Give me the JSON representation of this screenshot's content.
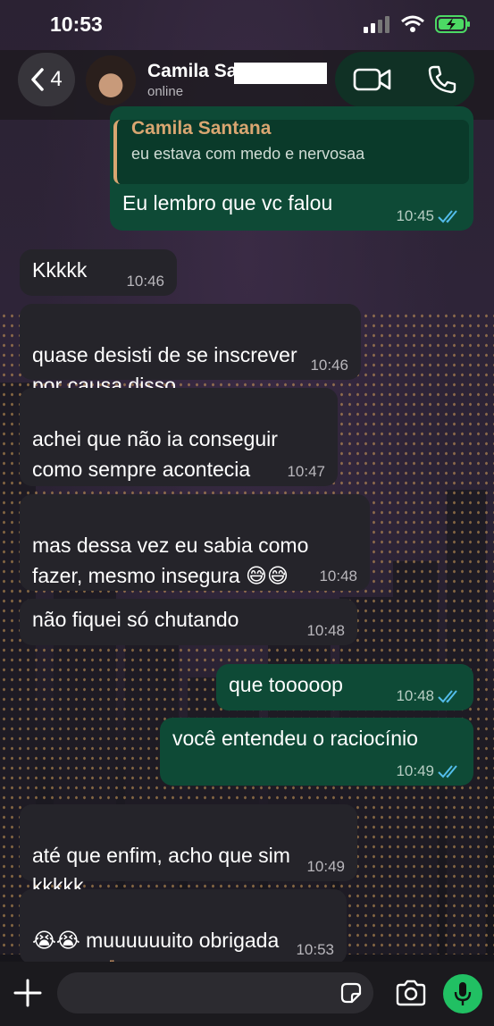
{
  "status_bar": {
    "time": "10:53"
  },
  "header": {
    "back_count": "4",
    "contact_name": "Camila Sa",
    "contact_status": "online"
  },
  "quoted": {
    "name": "Camila Santana",
    "text": "eu estava com medo e nervosaa"
  },
  "messages": [
    {
      "text": "Eu lembro que vc falou",
      "time": "10:45",
      "dir": "out"
    },
    {
      "text": "Kkkkk",
      "time": "10:46",
      "dir": "in"
    },
    {
      "text": "quase desisti de se inscrever\npor causa disso",
      "time": "10:46",
      "dir": "in"
    },
    {
      "text": "achei que não ia conseguir\ncomo sempre acontecia",
      "time": "10:47",
      "dir": "in"
    },
    {
      "text": "mas dessa vez eu sabia como\nfazer, mesmo insegura 😅😅",
      "time": "10:48",
      "dir": "in"
    },
    {
      "text": "não fiquei só chutando",
      "time": "10:48",
      "dir": "in"
    },
    {
      "text": "que tooooop",
      "time": "10:48",
      "dir": "out"
    },
    {
      "text": "você entendeu o raciocínio",
      "time": "10:49",
      "dir": "out"
    },
    {
      "text": "até que enfim, acho que sim\nkkkkk",
      "time": "10:49",
      "dir": "in"
    },
    {
      "text": "😭😭 muuuuuuito obrigada\nmesmo🙏🏼",
      "time": "10:53",
      "dir": "in"
    }
  ],
  "colors": {
    "incoming_bubble": "#25242a",
    "outgoing_bubble": "#0e4a36",
    "read_ticks": "#53bdeb",
    "mic_button": "#21c063",
    "quote_accent": "#d9a671"
  },
  "icons": {
    "status": [
      "signal-icon",
      "wifi-icon",
      "battery-icon"
    ],
    "header": [
      "chevron-left-icon",
      "video-call-icon",
      "phone-icon"
    ],
    "composer": [
      "plus-icon",
      "sticker-icon",
      "camera-icon",
      "mic-icon"
    ]
  }
}
